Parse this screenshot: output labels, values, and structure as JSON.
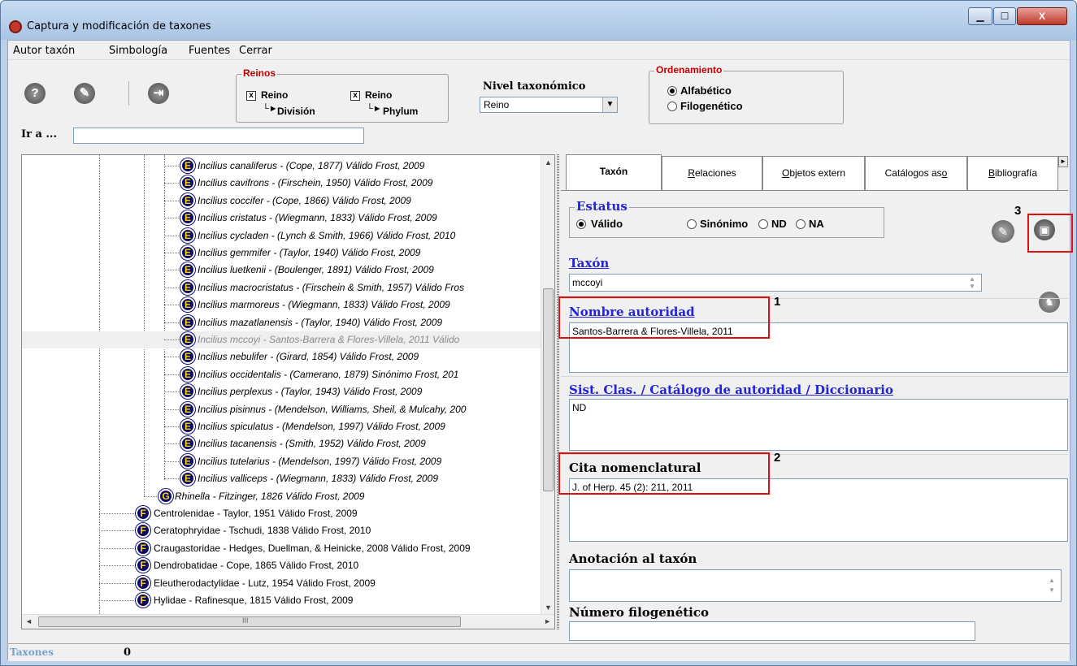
{
  "window": {
    "title": "Captura y modificación de taxones",
    "min": "▁",
    "max": "☐",
    "close": "X"
  },
  "menu": [
    "Autor taxón",
    "Simbología",
    "Fuentes",
    "Cerrar"
  ],
  "toolbar": {
    "help": "?",
    "edit": "✎",
    "exit": "⇥"
  },
  "reinos": {
    "legend": "Reinos",
    "opt1": "Reino",
    "opt1_sub": "División",
    "opt2": "Reino",
    "opt2_sub": "Phylum",
    "check": "x"
  },
  "nivel": {
    "label": "Nivel taxonómico",
    "value": "Reino"
  },
  "orden": {
    "legend": "Ordenamiento",
    "opt1": "Alfabético",
    "opt2": "Filogenético"
  },
  "ira": {
    "label": "Ir a ...",
    "value": ""
  },
  "tree": [
    {
      "badge": "E",
      "text": "Incilius canaliferus - (Cope, 1877)  Válido  Frost, 2009"
    },
    {
      "badge": "E",
      "text": "Incilius cavifrons - (Firschein, 1950)  Válido  Frost, 2009"
    },
    {
      "badge": "E",
      "text": "Incilius coccifer - (Cope, 1866)  Válido  Frost, 2009"
    },
    {
      "badge": "E",
      "text": "Incilius cristatus - (Wiegmann, 1833)  Válido  Frost, 2009"
    },
    {
      "badge": "E",
      "text": "Incilius cycladen - (Lynch & Smith, 1966)  Válido  Frost, 2010"
    },
    {
      "badge": "E",
      "text": "Incilius gemmifer - (Taylor, 1940)  Válido  Frost, 2009"
    },
    {
      "badge": "E",
      "text": "Incilius luetkenii - (Boulenger, 1891)  Válido  Frost, 2009"
    },
    {
      "badge": "E",
      "text": "Incilius macrocristatus - (Firschein & Smith, 1957)  Válido  Fros"
    },
    {
      "badge": "E",
      "text": "Incilius marmoreus - (Wiegmann, 1833)  Válido  Frost, 2009"
    },
    {
      "badge": "E",
      "text": "Incilius mazatlanensis - (Taylor, 1940)  Válido  Frost, 2009"
    },
    {
      "badge": "E",
      "text": "Incilius mccoyi - Santos-Barrera & Flores-Villela, 2011  Válido"
    },
    {
      "badge": "E",
      "text": "Incilius nebulifer - (Girard, 1854)  Válido  Frost, 2009"
    },
    {
      "badge": "E",
      "text": "Incilius occidentalis - (Camerano, 1879)  Sinónimo   Frost, 201"
    },
    {
      "badge": "E",
      "text": "Incilius perplexus - (Taylor, 1943)  Válido  Frost, 2009"
    },
    {
      "badge": "E",
      "text": "Incilius pisinnus - (Mendelson, Williams, Sheil, & Mulcahy, 200"
    },
    {
      "badge": "E",
      "text": "Incilius spiculatus - (Mendelson, 1997)  Válido  Frost, 2009"
    },
    {
      "badge": "E",
      "text": "Incilius tacanensis - (Smith, 1952)  Válido  Frost, 2009"
    },
    {
      "badge": "E",
      "text": "Incilius tutelarius - (Mendelson, 1997)  Válido  Frost, 2009"
    },
    {
      "badge": "E",
      "text": "Incilius valliceps - (Wiegmann, 1833)  Válido  Frost, 2009"
    },
    {
      "badge": "G",
      "text": "Rhinella - Fitzinger, 1826  Válido  Frost, 2009"
    },
    {
      "badge": "F",
      "text": "Centrolenidae - Taylor, 1951  Válido  Frost, 2009"
    },
    {
      "badge": "F",
      "text": "Ceratophryidae - Tschudi, 1838  Válido  Frost, 2010"
    },
    {
      "badge": "F",
      "text": "Craugastoridae - Hedges, Duellman, & Heinicke, 2008  Válido  Frost, 2009"
    },
    {
      "badge": "F",
      "text": "Dendrobatidae - Cope, 1865  Válido  Frost, 2010"
    },
    {
      "badge": "F",
      "text": "Eleutherodactylidae - Lutz, 1954  Válido  Frost, 2009"
    },
    {
      "badge": "F",
      "text": "Hylidae - Rafinesque, 1815  Válido  Frost, 2009"
    }
  ],
  "hscroll_mid": "III",
  "tabs": [
    {
      "label": "Taxón"
    },
    {
      "label": "Relaciones",
      "u": "R",
      "rest": "elaciones"
    },
    {
      "label": "Objetos extern",
      "u": "O",
      "rest": "bjetos extern"
    },
    {
      "label": "Catálogos aso",
      "pre": "Catálogos as",
      "u": "o"
    },
    {
      "label": "Bibliografía",
      "u": "B",
      "rest": "ibliografía"
    }
  ],
  "estatus": {
    "legend": "Estatus",
    "opt1": "Válido",
    "opt2": "Sinónimo",
    "opt3": "ND",
    "opt4": "NA"
  },
  "taxon": {
    "label": "Taxón",
    "value": "mccoyi"
  },
  "autoridad": {
    "label": "Nombre autoridad",
    "value": "Santos-Barrera & Flores-Villela, 2011"
  },
  "sist": {
    "label": "Sist. Clas. / Catálogo de autoridad / Diccionario",
    "value": "ND"
  },
  "cita": {
    "label": "Cita nomenclatural",
    "value": "J. of Herp. 45 (2): 211, 2011"
  },
  "anotacion": {
    "label": "Anotación al taxón",
    "value": ""
  },
  "filo": {
    "label": "Número filogenético",
    "value": ""
  },
  "callouts": {
    "n1": "1",
    "n2": "2",
    "n3": "3"
  },
  "status": {
    "label": "Taxones",
    "count": "0"
  }
}
